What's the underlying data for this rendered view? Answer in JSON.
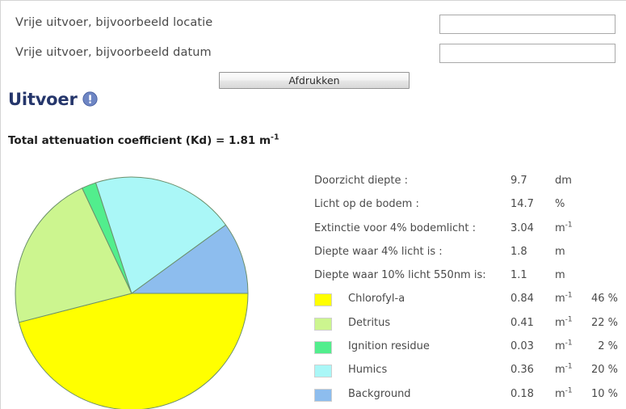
{
  "form": {
    "fields": [
      {
        "label": "Vrije uitvoer, bijvoorbeeld locatie",
        "value": "",
        "placeholder": ""
      },
      {
        "label": "Vrije uitvoer, bijvoorbeeld datum",
        "value": "",
        "placeholder": ""
      }
    ],
    "print_button": "Afdrukken"
  },
  "output": {
    "title": "Uitvoer",
    "info_icon": "exclamation-circle-icon",
    "kd_text": "Total attenuation coefficient (Kd) = 1.81 m",
    "kd_exponent": "-1"
  },
  "results": {
    "rows": [
      {
        "label": "Doorzicht diepte :",
        "value": "9.7",
        "unit": "dm",
        "unit_sup": "",
        "pct": ""
      },
      {
        "label": "Licht op de bodem :",
        "value": "14.7",
        "unit": "%",
        "unit_sup": "",
        "pct": ""
      },
      {
        "label": "Extinctie voor 4% bodemlicht :",
        "value": "3.04",
        "unit": "m",
        "unit_sup": "-1",
        "pct": ""
      },
      {
        "label": "Diepte waar 4% licht is :",
        "value": "1.8",
        "unit": "m",
        "unit_sup": "",
        "pct": ""
      },
      {
        "label": "Diepte waar 10% licht 550nm is:",
        "value": "1.1",
        "unit": "m",
        "unit_sup": "",
        "pct": ""
      }
    ],
    "legend": [
      {
        "label": "Chlorofyl-a",
        "value": "0.84",
        "unit": "m",
        "unit_sup": "-1",
        "pct": "46 %",
        "color": "#FFFF00"
      },
      {
        "label": "Detritus",
        "value": "0.41",
        "unit": "m",
        "unit_sup": "-1",
        "pct": "22 %",
        "color": "#CCF58F"
      },
      {
        "label": "Ignition residue",
        "value": "0.03",
        "unit": "m",
        "unit_sup": "-1",
        "pct": "2 %",
        "color": "#52EE8D"
      },
      {
        "label": "Humics",
        "value": "0.36",
        "unit": "m",
        "unit_sup": "-1",
        "pct": "20 %",
        "color": "#AAF7F7"
      },
      {
        "label": "Background",
        "value": "0.18",
        "unit": "m",
        "unit_sup": "-1",
        "pct": "10 %",
        "color": "#8DBDEE"
      }
    ]
  },
  "chart_data": {
    "type": "pie",
    "title": "",
    "labels": [
      "Chlorofyl-a",
      "Detritus",
      "Ignition residue",
      "Humics",
      "Background"
    ],
    "values": [
      0.84,
      0.41,
      0.03,
      0.36,
      0.18
    ],
    "percentages": [
      46,
      22,
      2,
      20,
      10
    ],
    "units": "m^-1",
    "colors": [
      "#FFFF00",
      "#CCF58F",
      "#52EE8D",
      "#AAF7F7",
      "#8DBDEE"
    ],
    "start_angle_deg": 0,
    "direction": "clockwise",
    "legend_position": "right",
    "stroke": "#6b8f6b"
  },
  "theme": {
    "accent": "#25366b",
    "text": "#4a4a4a",
    "border": "#a9a9a9"
  }
}
